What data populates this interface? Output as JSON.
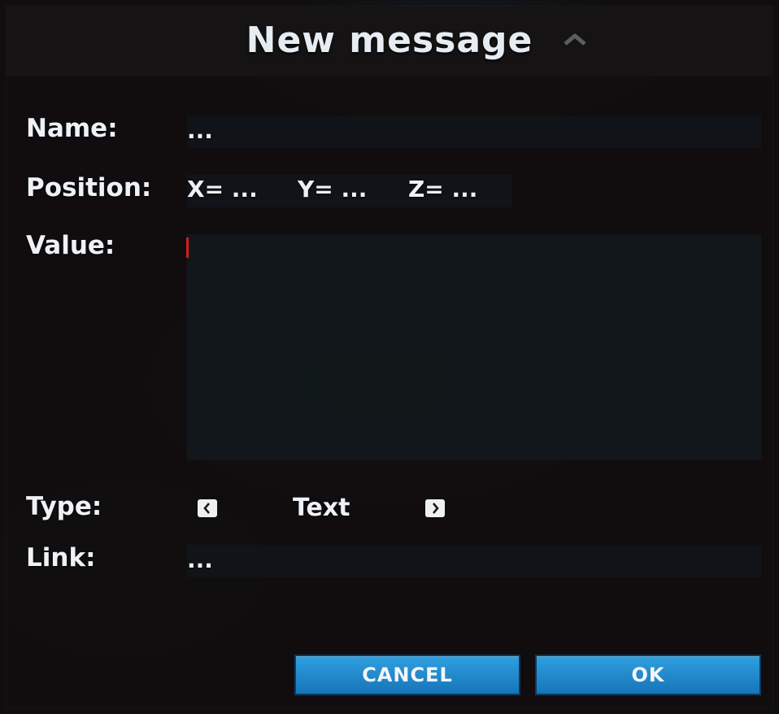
{
  "dialog": {
    "title": "New message",
    "collapse_icon": "chevron-up-icon"
  },
  "form": {
    "name_label": "Name:",
    "name_value": "...",
    "position_label": "Position:",
    "x_value": "X= ...",
    "y_value": "Y= ...",
    "z_value": "Z= ...",
    "value_label": "Value:",
    "value_text": "",
    "type_label": "Type:",
    "type_value": "Text",
    "type_prev_icon": "chevron-left-icon",
    "type_next_icon": "chevron-right-icon",
    "link_label": "Link:",
    "link_value": "..."
  },
  "buttons": {
    "cancel": "CANCEL",
    "ok": "OK"
  },
  "colors": {
    "button_blue": "#2f9fe0",
    "caret_red": "#d21d1d"
  }
}
